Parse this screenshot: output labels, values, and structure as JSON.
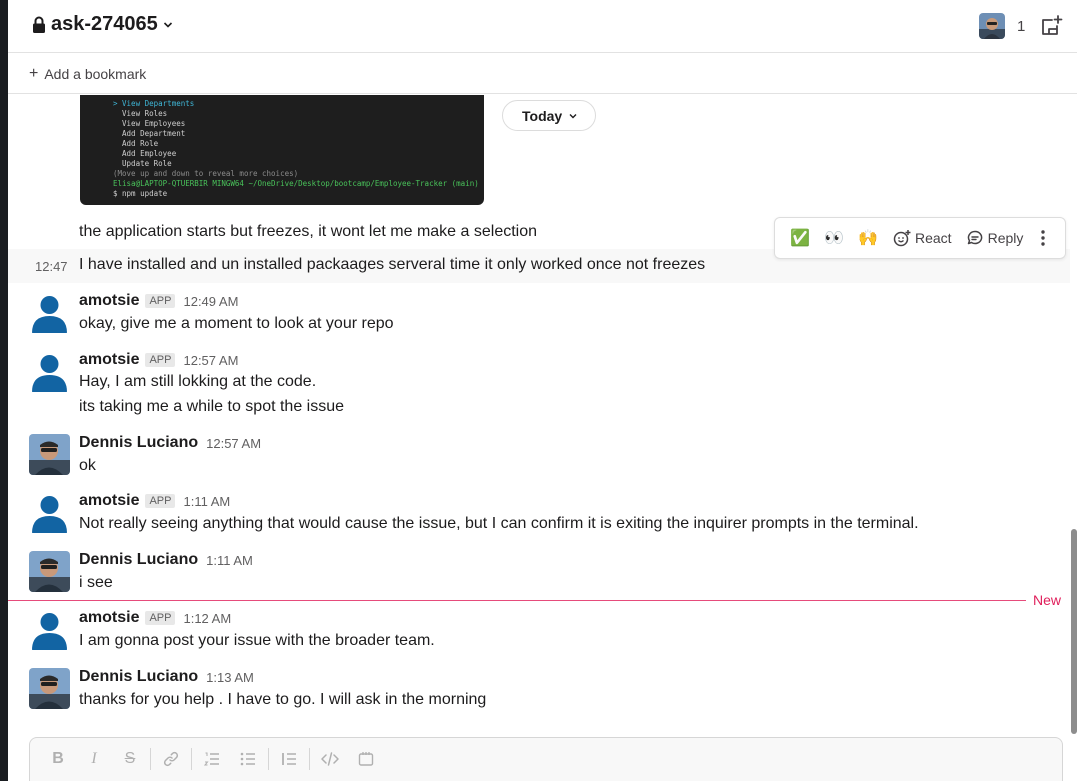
{
  "header": {
    "channel_name": "ask-274065",
    "member_count": "1"
  },
  "bookmarks": {
    "add_label": "Add a bookmark"
  },
  "code_screenshot": {
    "lines": [
      "> View Departments",
      "  View Roles",
      "  View Employees",
      "  Add Department",
      "  Add Role",
      "  Add Employee",
      "  Update Role",
      "(Move up and down to reveal more choices)",
      "Elisa@LAPTOP-QTUERBIR MINGW64 ~/OneDrive/Desktop/bootcamp/Employee-Tracker (main)",
      "$ npm update"
    ]
  },
  "date_divider": {
    "label": "Today"
  },
  "continuation_messages": [
    {
      "text": "the application starts but freezes, it wont let me make a selection"
    },
    {
      "time": "12:47",
      "text": "I have installed and un installed packaages serveral time it only worked once not freezes"
    }
  ],
  "hover_toolbar": {
    "emojis": [
      "✅",
      "👀",
      "🙌"
    ],
    "react_label": "React",
    "reply_label": "Reply"
  },
  "messages": [
    {
      "sender": "amotsie",
      "badge": "APP",
      "time": "12:49 AM",
      "lines": [
        "okay, give me a moment to look at your repo"
      ]
    },
    {
      "sender": "amotsie",
      "badge": "APP",
      "time": "12:57 AM",
      "lines": [
        "Hay, I am still lokking at the code.",
        "its taking me a while to spot the issue"
      ]
    },
    {
      "sender": "Dennis Luciano",
      "time": "12:57 AM",
      "lines": [
        "ok"
      ]
    },
    {
      "sender": "amotsie",
      "badge": "APP",
      "time": "1:11 AM",
      "lines": [
        "Not really seeing anything that would cause the issue, but I can confirm it is exiting the inquirer prompts in the terminal."
      ]
    },
    {
      "sender": "Dennis Luciano",
      "time": "1:11 AM",
      "lines": [
        "i see"
      ]
    },
    {
      "sender": "amotsie",
      "badge": "APP",
      "time": "1:12 AM",
      "lines": [
        "I am gonna post your issue with the broader team."
      ]
    },
    {
      "sender": "Dennis Luciano",
      "time": "1:13 AM",
      "lines": [
        "thanks for you help . I have to go. I will ask in the morning"
      ]
    }
  ],
  "new_divider": {
    "label": "New"
  },
  "composer": {
    "format_buttons": [
      "bold",
      "italic",
      "strikethrough",
      "link",
      "ordered-list",
      "bulleted-list",
      "blockquote",
      "code",
      "code-block"
    ]
  },
  "colors": {
    "accent_new": "#e01e5a",
    "text": "#1d1c1d",
    "muted": "#616061",
    "generic_avatar": "#1264a3"
  }
}
